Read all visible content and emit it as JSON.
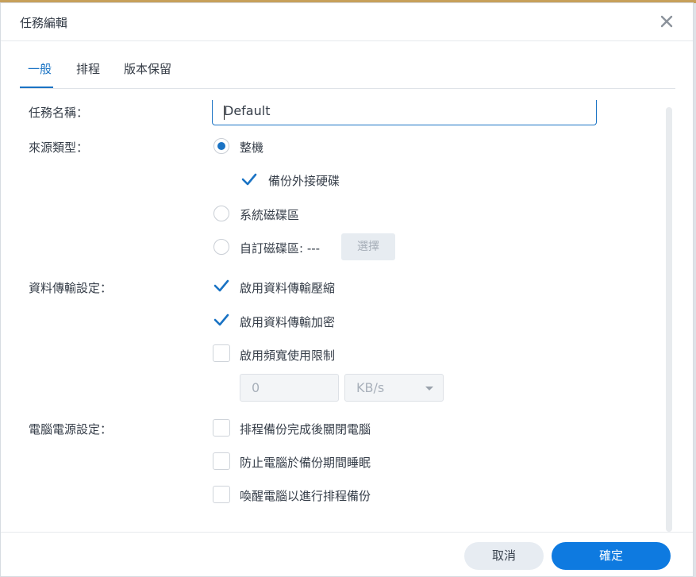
{
  "dialog": {
    "title": "任務編輯"
  },
  "tabs": [
    {
      "label": "一般",
      "active": true
    },
    {
      "label": "排程",
      "active": false
    },
    {
      "label": "版本保留",
      "active": false
    }
  ],
  "task_name": {
    "label": "任務名稱：",
    "value": "Default"
  },
  "source_type": {
    "label": "來源類型：",
    "options": {
      "whole_machine": {
        "label": "整機",
        "selected": true
      },
      "external_disk": {
        "label": "備份外接硬碟",
        "checked": true
      },
      "system_volume": {
        "label": "系統磁碟區",
        "selected": false
      },
      "custom_volume": {
        "label": "自訂磁碟區: ---",
        "selected": false
      }
    },
    "select_button": "選擇"
  },
  "transfer_settings": {
    "label": "資料傳輸設定：",
    "compression": {
      "label": "啟用資料傳輸壓縮",
      "checked": true
    },
    "encryption": {
      "label": "啟用資料傳輸加密",
      "checked": true
    },
    "bandwidth_limit": {
      "label": "啟用頻寬使用限制",
      "checked": false
    },
    "bandwidth_value": "0",
    "bandwidth_unit": "KB/s"
  },
  "power_settings": {
    "label": "電腦電源設定：",
    "shutdown": {
      "label": "排程備份完成後關閉電腦",
      "checked": false
    },
    "prevent_sleep": {
      "label": "防止電腦於備份期間睡眠",
      "checked": false
    },
    "wake": {
      "label": "喚醒電腦以進行排程備份",
      "checked": false
    }
  },
  "footer": {
    "cancel": "取消",
    "ok": "確定"
  },
  "colors": {
    "accent": "#1a73c4",
    "primary_button": "#0e7ae0"
  },
  "icons": {
    "close": "close-icon",
    "check": "checkmark-icon",
    "dropdown": "chevron-down-icon"
  }
}
